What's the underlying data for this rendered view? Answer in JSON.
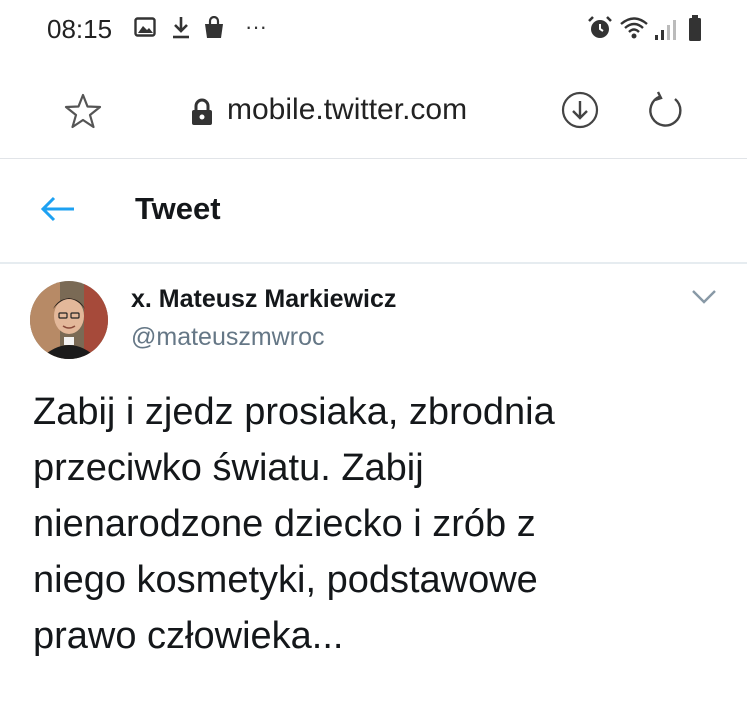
{
  "status_bar": {
    "time": "08:15",
    "overflow": "···"
  },
  "browser": {
    "url": "mobile.twitter.com",
    "icons": [
      "star-icon",
      "lock-icon",
      "download-icon",
      "reload-icon"
    ]
  },
  "header": {
    "title": "Tweet",
    "back_icon": "arrow-left-icon"
  },
  "tweet": {
    "author_name": "x. Mateusz Markiewicz",
    "author_handle": "@mateuszmwroc",
    "text": "Zabij i zjedz prosiaka, zbrodnia\nprzeciwko światu. Zabij\nnienarodzone dziecko i zrób z\nniego kosmetyki, podstawowe\nprawo człowieka..."
  },
  "colors": {
    "accent": "#1da1f2",
    "text_primary": "#14171a",
    "text_secondary": "#657786"
  }
}
